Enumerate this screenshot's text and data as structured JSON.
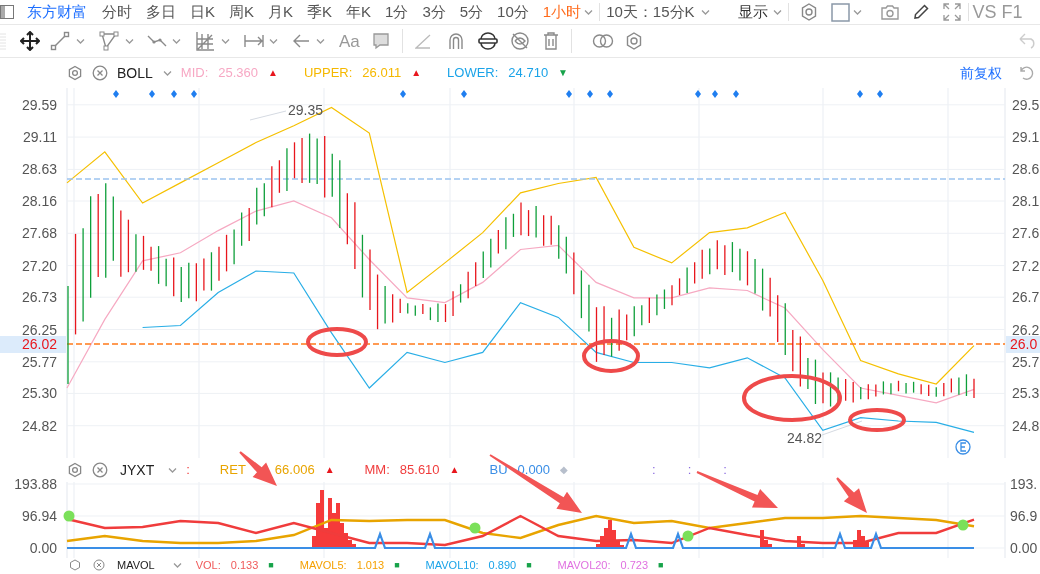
{
  "nav": {
    "brand": "东方财富",
    "periods": [
      {
        "label": "分时",
        "selected": false,
        "dropdown": false
      },
      {
        "label": "多日",
        "selected": false,
        "dropdown": false
      },
      {
        "label": "日K",
        "selected": false,
        "dropdown": false
      },
      {
        "label": "周K",
        "selected": false,
        "dropdown": false
      },
      {
        "label": "月K",
        "selected": false,
        "dropdown": false
      },
      {
        "label": "季K",
        "selected": false,
        "dropdown": false
      },
      {
        "label": "年K",
        "selected": false,
        "dropdown": false
      },
      {
        "label": "1分",
        "selected": false,
        "dropdown": false
      },
      {
        "label": "3分",
        "selected": false,
        "dropdown": false
      },
      {
        "label": "5分",
        "selected": false,
        "dropdown": false
      },
      {
        "label": "10分",
        "selected": false,
        "dropdown": false
      },
      {
        "label": "1小时",
        "selected": true,
        "dropdown": true
      }
    ],
    "range": "10天：15分K",
    "display": "显示",
    "vs": "VS F1"
  },
  "toolbar": {
    "text_tool": "Aa"
  },
  "main_legend": {
    "indicator": "BOLL",
    "adjust": "前复权",
    "items": [
      {
        "label": "MID:",
        "value": "25.360",
        "marker": "▲",
        "rising": true,
        "neutral": false,
        "color": "#f7a8c4"
      },
      {
        "label": "UPPER:",
        "value": "26.011",
        "marker": "▲",
        "rising": true,
        "neutral": false,
        "color": "#f5b800"
      },
      {
        "label": "LOWER:",
        "value": "24.710",
        "marker": "▼",
        "rising": false,
        "neutral": false,
        "color": "#1aa3e8"
      }
    ]
  },
  "main_chart": {
    "current_price": "26.02",
    "right_current_price": "26.0",
    "right_axis_labels": [
      "29.5",
      "29.1",
      "28.6",
      "28.1",
      "27.6",
      "27.2",
      "26.7",
      "26.2",
      "25.7",
      "25.3",
      "24.8"
    ],
    "price_labels": [
      "29.35",
      "24.82"
    ],
    "chart_data": {
      "type": "line",
      "grid": true,
      "categories": [
        null,
        null,
        null,
        null,
        null,
        null,
        null,
        null,
        null,
        null,
        null,
        null,
        null,
        null,
        null,
        null,
        null,
        null,
        null,
        null,
        null,
        null,
        null,
        null,
        null
      ],
      "ylim": [
        24.34,
        29.84
      ],
      "yticks": [
        {
          "value": 29.59,
          "label": "29.59"
        },
        {
          "value": 29.11,
          "label": "29.11"
        },
        {
          "value": 28.63,
          "label": "28.63"
        },
        {
          "value": 28.16,
          "label": "28.16"
        },
        {
          "value": 27.68,
          "label": "27.68"
        },
        {
          "value": 27.2,
          "label": "27.20"
        },
        {
          "value": 26.73,
          "label": "26.73"
        },
        {
          "value": 26.25,
          "label": "26.25"
        },
        {
          "value": 25.77,
          "label": "25.77"
        },
        {
          "value": 25.3,
          "label": "25.30"
        },
        {
          "value": 24.82,
          "label": "24.82"
        }
      ],
      "series": [
        {
          "color": "#f5c000",
          "values": [
            28.43,
            28.89,
            28.13,
            28.43,
            28.73,
            29.03,
            29.28,
            29.55,
            29.17,
            26.8,
            27.24,
            27.69,
            28.28,
            28.42,
            28.51,
            27.47,
            27.24,
            27.69,
            27.76,
            27.99,
            26.98,
            25.79,
            25.59,
            25.44,
            26.01
          ]
        },
        {
          "color": "#f6a9c2",
          "values": [
            25.38,
            26.4,
            27.27,
            27.39,
            27.72,
            28.01,
            28.16,
            27.91,
            27.29,
            26.72,
            26.65,
            26.95,
            27.44,
            27.5,
            26.95,
            26.72,
            26.72,
            26.87,
            26.83,
            26.57,
            25.95,
            25.38,
            25.27,
            25.16,
            25.36
          ]
        },
        {
          "color": "#29aee6",
          "values": [
            null,
            null,
            26.28,
            26.31,
            26.8,
            27.12,
            27.09,
            26.2,
            25.38,
            25.91,
            25.76,
            25.91,
            26.65,
            26.43,
            25.91,
            25.76,
            25.76,
            25.68,
            25.83,
            25.53,
            24.75,
            24.94,
            24.89,
            24.87,
            24.72
          ]
        }
      ]
    }
  },
  "sub_legend": {
    "indicator": "JYXT",
    "separator": ":",
    "items": [
      {
        "label": "RET",
        "value": "66.006",
        "marker": "▲",
        "rising": true,
        "neutral": false,
        "color": "#e8a400"
      },
      {
        "label": "MM:",
        "value": "85.610",
        "marker": "▲",
        "rising": true,
        "neutral": false,
        "color": "#f03c3c"
      },
      {
        "label": "BU",
        "value": "0.000",
        "marker": "◆",
        "rising": false,
        "neutral": true,
        "color": "#3a8ee6"
      }
    ],
    "empty_labels": [
      ":",
      ":",
      ":"
    ]
  },
  "sub_chart": {
    "y_axis_labels": [
      "193.88",
      "96.94",
      "0.00"
    ],
    "right_axis_labels": [
      "193.",
      "96.9",
      "0.00"
    ]
  },
  "volume_legend": {
    "indicator": "MAVOL",
    "items": [
      {
        "label": "VOL:",
        "value": "0.133",
        "marker": "■",
        "rising": false,
        "neutral": false,
        "color": "#f05a5a"
      },
      {
        "label": "MAVOL5:",
        "value": "1.013",
        "marker": "■",
        "rising": false,
        "neutral": false,
        "color": "#f5a000"
      },
      {
        "label": "MAVOL10:",
        "value": "0.890",
        "marker": "■",
        "rising": false,
        "neutral": false,
        "color": "#1aa3e8"
      },
      {
        "label": "MAVOL20:",
        "value": "0.723",
        "marker": "■",
        "rising": false,
        "neutral": false,
        "color": "#e070e0"
      }
    ]
  }
}
